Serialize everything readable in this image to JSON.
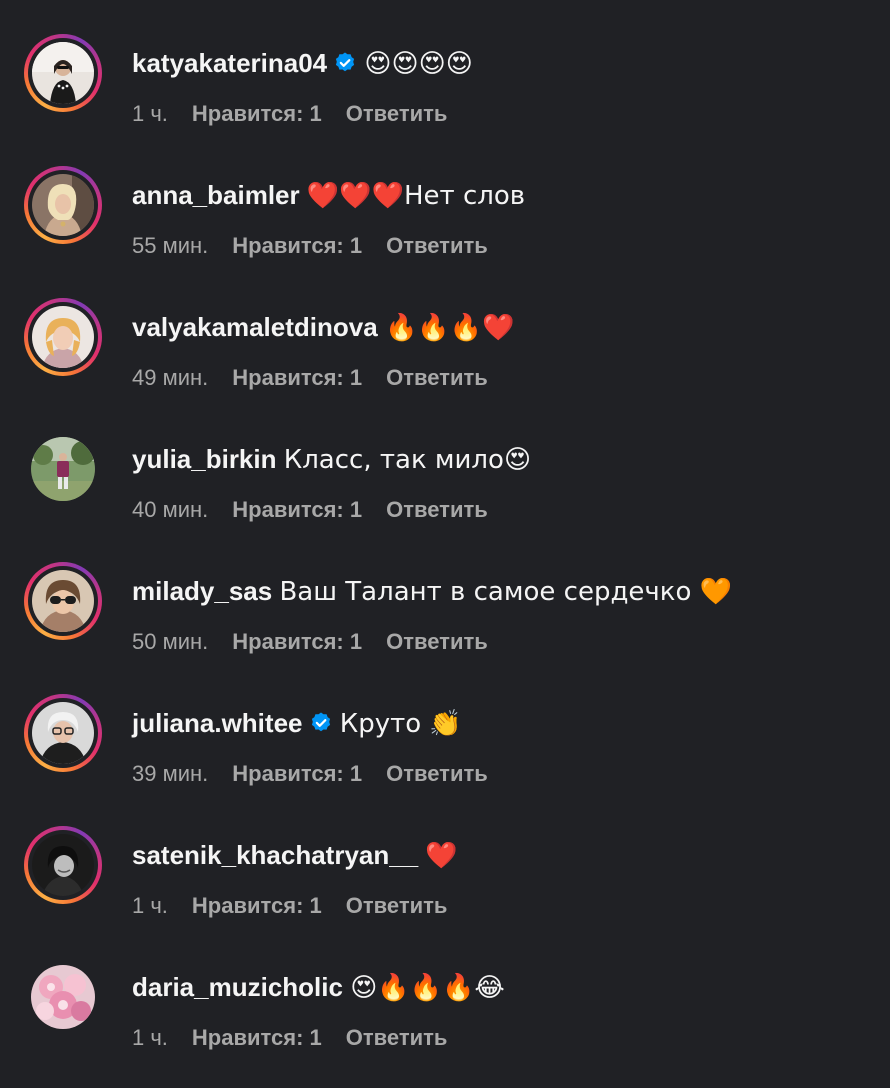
{
  "comments": [
    {
      "username": "katyakaterina04",
      "verified": true,
      "text": "😍😍😍😍",
      "time": "1 ч.",
      "likes": "Нравится: 1",
      "reply": "Ответить",
      "has_story_ring": true
    },
    {
      "username": "anna_baimler",
      "verified": false,
      "text": "❤️❤️❤️Нет слов",
      "time": "55 мин.",
      "likes": "Нравится: 1",
      "reply": "Ответить",
      "has_story_ring": true
    },
    {
      "username": "valyakamaletdinova",
      "verified": false,
      "text": "🔥🔥🔥❤️",
      "time": "49 мин.",
      "likes": "Нравится: 1",
      "reply": "Ответить",
      "has_story_ring": true
    },
    {
      "username": "yulia_birkin",
      "verified": false,
      "text": "Класс, так мило😍",
      "time": "40 мин.",
      "likes": "Нравится: 1",
      "reply": "Ответить",
      "has_story_ring": false
    },
    {
      "username": "milady_sas",
      "verified": false,
      "text": "Ваш Талант в самое сердечко 🧡",
      "time": "50 мин.",
      "likes": "Нравится: 1",
      "reply": "Ответить",
      "has_story_ring": true
    },
    {
      "username": "juliana.whitee",
      "verified": true,
      "text": "Круто 👏",
      "time": "39 мин.",
      "likes": "Нравится: 1",
      "reply": "Ответить",
      "has_story_ring": true
    },
    {
      "username": "satenik_khachatryan__",
      "verified": false,
      "text": "❤️",
      "time": "1 ч.",
      "likes": "Нравится: 1",
      "reply": "Ответить",
      "has_story_ring": true
    },
    {
      "username": "daria_muzicholic",
      "verified": false,
      "text": "😍🔥🔥🔥😂",
      "time": "1 ч.",
      "likes": "Нравится: 1",
      "reply": "Ответить",
      "has_story_ring": false
    }
  ],
  "colors": {
    "background": "#202125",
    "text_primary": "#f5f5f5",
    "text_secondary": "#a8a8a8",
    "verified_badge": "#0095f6"
  },
  "icons": {
    "verified": "verified-badge-icon"
  }
}
